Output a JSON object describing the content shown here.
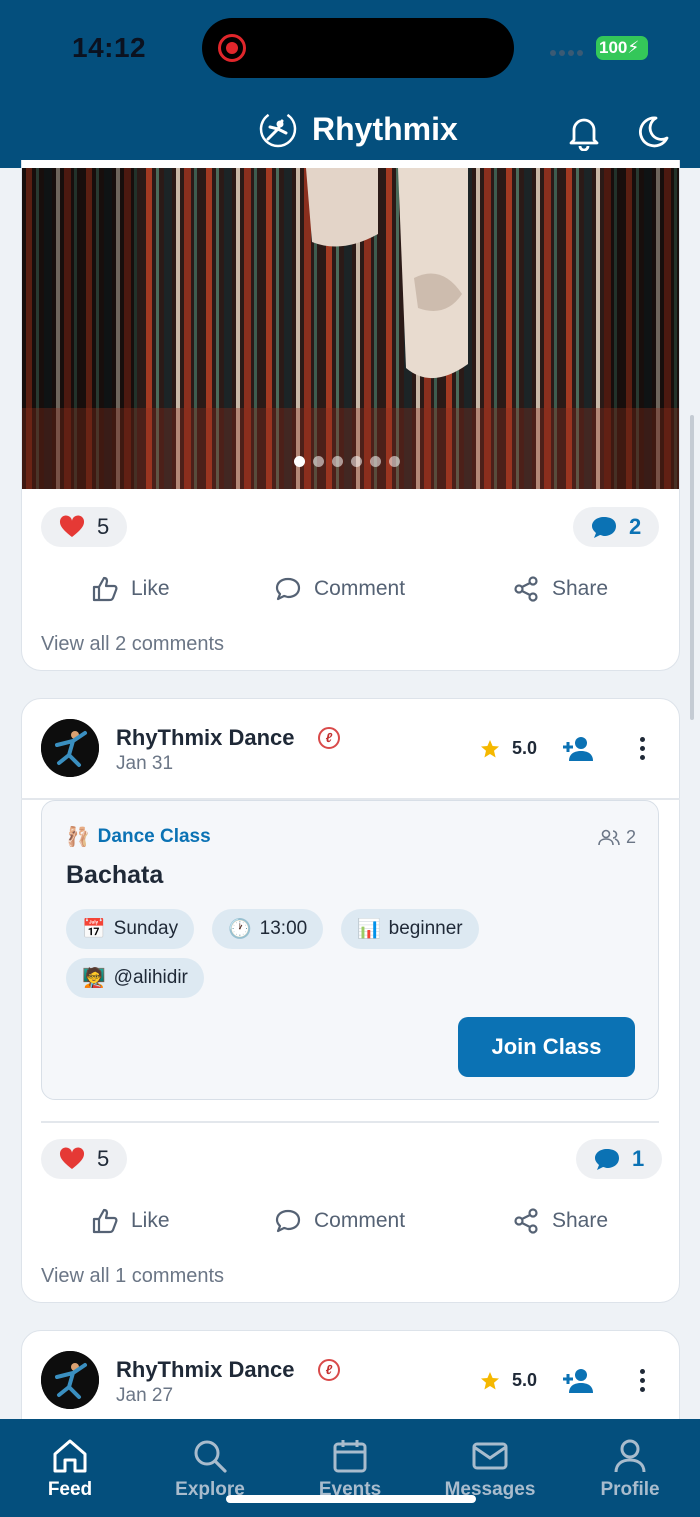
{
  "status_bar": {
    "time": "14:12",
    "battery": "100"
  },
  "header": {
    "title": "Rhythmix"
  },
  "post1": {
    "likes": "5",
    "comments": "2",
    "actions": {
      "like": "Like",
      "comment": "Comment",
      "share": "Share"
    },
    "view_all": "View all 2 comments",
    "carousel_count": 6,
    "carousel_active": 1
  },
  "post2": {
    "author": "RhyThmix Dance",
    "date": "Jan 31",
    "rating": "5.0",
    "class": {
      "type": "Dance Class",
      "type_emoji": "🩰",
      "attendees": "2",
      "title": "Bachata",
      "chips": [
        {
          "emoji": "📅",
          "text": "Sunday"
        },
        {
          "emoji": "🕐",
          "text": "13:00"
        },
        {
          "emoji": "📊",
          "text": "beginner"
        },
        {
          "emoji": "🧑‍🏫",
          "text": "@alihidir"
        }
      ],
      "join_label": "Join Class"
    },
    "likes": "5",
    "comments": "1",
    "actions": {
      "like": "Like",
      "comment": "Comment",
      "share": "Share"
    },
    "view_all": "View all 1 comments"
  },
  "post3": {
    "author": "RhyThmix Dance",
    "date": "Jan 27",
    "rating": "5.0"
  },
  "tabbar": {
    "items": [
      {
        "label": "Feed",
        "icon": "home-icon",
        "active": true
      },
      {
        "label": "Explore",
        "icon": "search-icon",
        "active": false
      },
      {
        "label": "Events",
        "icon": "calendar-icon",
        "active": false
      },
      {
        "label": "Messages",
        "icon": "mail-icon",
        "active": false
      },
      {
        "label": "Profile",
        "icon": "user-icon",
        "active": false
      }
    ]
  },
  "colors": {
    "primary": "#044f7d",
    "accent": "#0b72b4",
    "heart": "#e53935",
    "star": "#f5b800"
  }
}
